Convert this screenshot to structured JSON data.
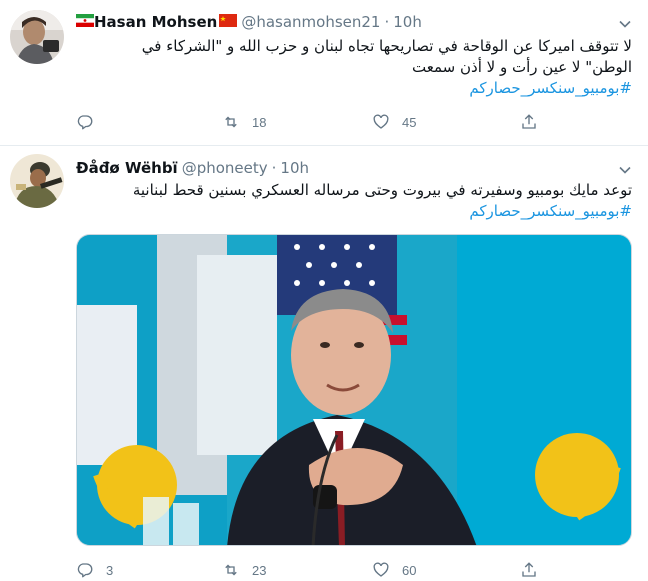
{
  "tweets": [
    {
      "name": "Hasan Mohsen",
      "handle": "@hasanmohsen21",
      "separator": "·",
      "time": "10h",
      "text_line1": "لا تتوقف اميركا عن الوقاحة في تصاريحها تجاه لبنان و حزب الله و \"الشركاء في",
      "text_line2": "الوطن\" لا عين رأت و لا أذن سمعت",
      "hashtag": "#بومبيو_سنكسر_حصاركم",
      "replies": "",
      "retweets": "18",
      "likes": "45"
    },
    {
      "name": "Ðåđø Wëhbï",
      "handle": "@phoneety",
      "separator": "·",
      "time": "10h",
      "text_line1": "توعد مايك بومبيو  وسفيرته في بيروت  وحتى مرساله العسكري بسنين قحط لبنانية",
      "hashtag": "#بومبيو_سنكسر_حصاركم",
      "replies": "3",
      "retweets": "23",
      "likes": "60"
    }
  ],
  "icons": [
    "reply-icon",
    "retweet-icon",
    "like-icon",
    "share-icon",
    "caret-down-icon"
  ],
  "colors": {
    "accent": "#1b95e0",
    "muted": "#657786",
    "divider": "#e6ecf0"
  }
}
